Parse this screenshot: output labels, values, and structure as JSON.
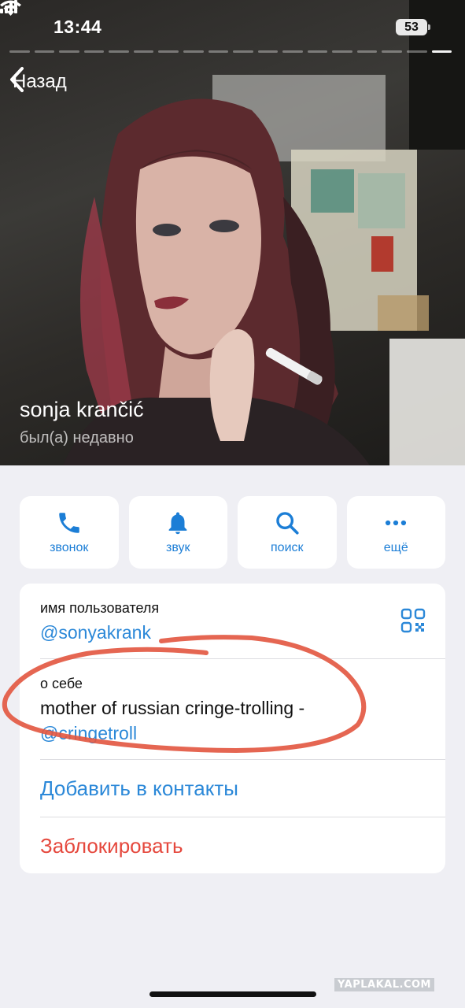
{
  "status_bar": {
    "time": "13:44",
    "battery": "53"
  },
  "nav": {
    "back_label": "Назад"
  },
  "profile": {
    "name": "sonja krančić",
    "last_seen": "был(а) недавно"
  },
  "actions": [
    {
      "label": "звонок",
      "icon": "phone-icon"
    },
    {
      "label": "звук",
      "icon": "bell-icon"
    },
    {
      "label": "поиск",
      "icon": "search-icon"
    },
    {
      "label": "ещё",
      "icon": "more-icon"
    }
  ],
  "info": {
    "username_label": "имя пользователя",
    "username": "@sonyakrank",
    "about_label": "о себе",
    "about_text": "mother of russian cringe-trolling -",
    "about_link": "@cringetroll",
    "add_contact": "Добавить в контакты",
    "block": "Заблокировать"
  },
  "watermark": "YAPLAKAL.COM",
  "colors": {
    "accent": "#2b88d8",
    "danger": "#e5483d",
    "annotation": "#e2553f"
  }
}
